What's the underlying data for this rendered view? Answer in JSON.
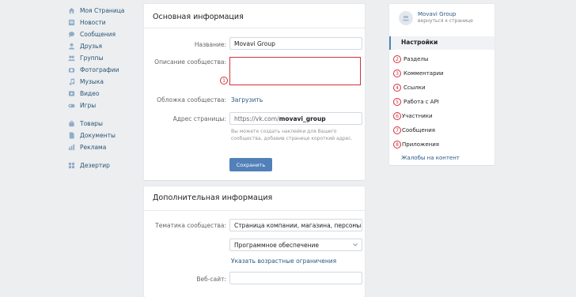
{
  "leftnav": {
    "items": [
      {
        "label": "Моя Страница",
        "icon": "home-icon"
      },
      {
        "label": "Новости",
        "icon": "news-icon"
      },
      {
        "label": "Сообщения",
        "icon": "message-icon"
      },
      {
        "label": "Друзья",
        "icon": "user-icon"
      },
      {
        "label": "Группы",
        "icon": "group-icon"
      },
      {
        "label": "Фотографии",
        "icon": "camera-icon"
      },
      {
        "label": "Музыка",
        "icon": "music-icon"
      },
      {
        "label": "Видео",
        "icon": "video-icon"
      },
      {
        "label": "Игры",
        "icon": "games-icon"
      }
    ],
    "items2": [
      {
        "label": "Товары",
        "icon": "bag-icon"
      },
      {
        "label": "Документы",
        "icon": "document-icon"
      },
      {
        "label": "Реклама",
        "icon": "ads-icon"
      }
    ],
    "items3": [
      {
        "label": "Дезертир",
        "icon": "app-icon"
      }
    ]
  },
  "main": {
    "title": "Основная информация",
    "name_label": "Название:",
    "name_value": "Movavi Group",
    "desc_label": "Описание сообщества:",
    "desc_value": "",
    "cover_label": "Обложка сообщества:",
    "cover_link": "Загрузить",
    "address_label": "Адрес страницы:",
    "address_prefix": "https://vk.com/",
    "address_value": "movavi_group",
    "address_hint": "Вы можете создать наклейки для Вашего сообщества, добавив странице короткий адрес.",
    "save_label": "Сохранить"
  },
  "extra": {
    "title": "Дополнительная информация",
    "topic_label": "Тематика сообщества:",
    "topic_value": "Страница компании, магазина, персоны",
    "subtopic_value": "Программное обеспечение",
    "age_link": "Указать возрастные ограничения",
    "website_label": "Веб-сайт:",
    "website_value": ""
  },
  "right": {
    "group_name": "Movavi Group",
    "group_back": "вернуться к странице",
    "active": "Настройки",
    "items": [
      {
        "num": "2",
        "label": "Разделы"
      },
      {
        "num": "3",
        "label": "Комментарии"
      },
      {
        "num": "4",
        "label": "Ссылки"
      },
      {
        "num": "5",
        "label": "Работа с API"
      },
      {
        "num": "6",
        "label": "Участники"
      },
      {
        "num": "7",
        "label": "Сообщения"
      },
      {
        "num": "8",
        "label": "Приложения"
      }
    ],
    "last": "Жалобы на контент"
  },
  "badge1": "1",
  "colors": {
    "accent": "#5181b8",
    "link": "#2a5885",
    "annotation": "#d1313c",
    "background": "#edeef0"
  }
}
